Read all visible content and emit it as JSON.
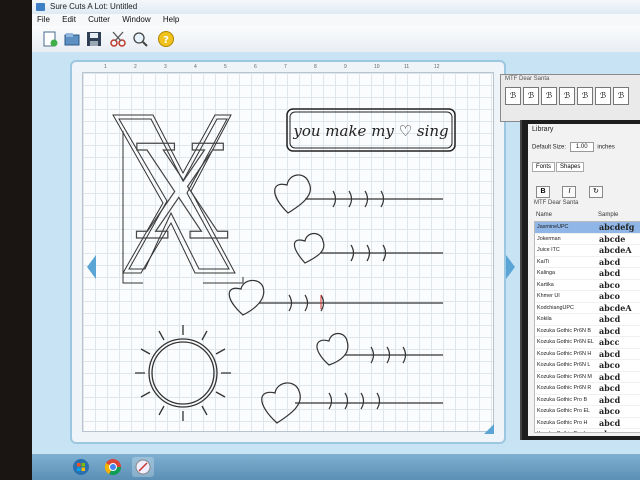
{
  "window": {
    "title": "Sure Cuts A Lot: Untitled"
  },
  "menu": {
    "items": [
      "File",
      "Edit",
      "Cutter",
      "Window",
      "Help"
    ]
  },
  "toolbar": {
    "icons": [
      "new-icon",
      "open-icon",
      "save-icon",
      "scissors-icon",
      "zoom-icon",
      "help-icon"
    ]
  },
  "canvas": {
    "text": "you make my ♡ sing",
    "letter": "X"
  },
  "ruler": {
    "marks": [
      "1",
      "2",
      "3",
      "4",
      "5",
      "6",
      "7",
      "8",
      "9",
      "10",
      "11",
      "12"
    ]
  },
  "glyph_panel": {
    "title": "MTF Dear Santa"
  },
  "library": {
    "title": "Library",
    "size_label": "Default Size:",
    "size_value": "1.00",
    "size_unit": "inches",
    "tabs": [
      "Fonts",
      "Shapes"
    ],
    "style_buttons": [
      "B",
      "I",
      "C"
    ],
    "font_family": "MTF Dear Santa",
    "columns": [
      "Name",
      "Sample"
    ],
    "fonts": [
      {
        "name": "JasmineUPC",
        "sample": "abcdefg",
        "selected": true
      },
      {
        "name": "Jokerman",
        "sample": "abcde"
      },
      {
        "name": "Juice ITC",
        "sample": "abcdeA"
      },
      {
        "name": "KaiTi",
        "sample": "abcd"
      },
      {
        "name": "Kalinga",
        "sample": "abcd"
      },
      {
        "name": "Kartika",
        "sample": "abco"
      },
      {
        "name": "Khmer UI",
        "sample": "abco"
      },
      {
        "name": "KodchiangUPC",
        "sample": "abcdeA"
      },
      {
        "name": "Kokila",
        "sample": "abcd"
      },
      {
        "name": "Kozuka Gothic Pr6N B",
        "sample": "abcd"
      },
      {
        "name": "Kozuka Gothic Pr6N EL",
        "sample": "abcc"
      },
      {
        "name": "Kozuka Gothic Pr6N H",
        "sample": "abcd"
      },
      {
        "name": "Kozuka Gothic Pr6N L",
        "sample": "abco"
      },
      {
        "name": "Kozuka Gothic Pr6N M",
        "sample": "abcd"
      },
      {
        "name": "Kozuka Gothic Pr6N R",
        "sample": "abcd"
      },
      {
        "name": "Kozuka Gothic Pro B",
        "sample": "abcd"
      },
      {
        "name": "Kozuka Gothic Pro EL",
        "sample": "abco"
      },
      {
        "name": "Kozuka Gothic Pro H",
        "sample": "abcd"
      },
      {
        "name": "Kozuka Gothic Pro L",
        "sample": "abco"
      },
      {
        "name": "Kozuka Gothic Pro M",
        "sample": "abcd"
      }
    ]
  },
  "taskbar": {
    "icons": [
      "windows-start-icon",
      "chrome-icon",
      "sure-cuts-icon"
    ]
  }
}
